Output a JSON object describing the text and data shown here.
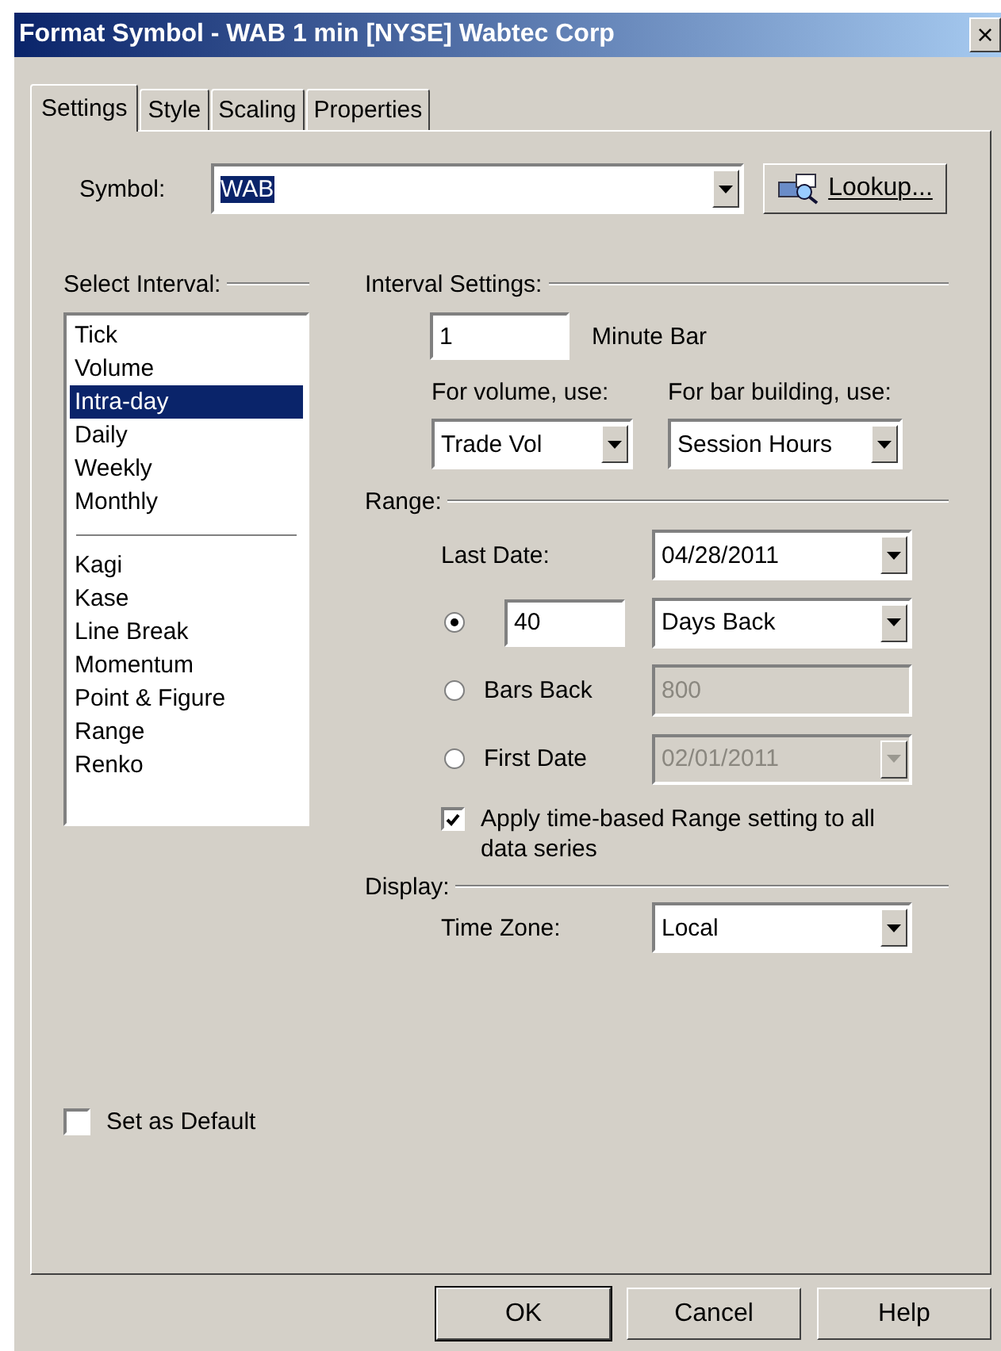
{
  "window": {
    "title": "Format Symbol - WAB 1 min [NYSE] Wabtec Corp",
    "close": "×"
  },
  "tabs": [
    {
      "label": "Settings",
      "selected": true
    },
    {
      "label": "Style",
      "selected": false
    },
    {
      "label": "Scaling",
      "selected": false
    },
    {
      "label": "Properties",
      "selected": false
    }
  ],
  "symbol": {
    "label": "Symbol:",
    "value": "WAB",
    "lookup": "Lookup..."
  },
  "select_interval": {
    "label": "Select Interval:",
    "groups": [
      {
        "items": [
          {
            "label": "Tick",
            "selected": false
          },
          {
            "label": "Volume",
            "selected": false
          },
          {
            "label": "Intra-day",
            "selected": true
          },
          {
            "label": "Daily",
            "selected": false
          },
          {
            "label": "Weekly",
            "selected": false
          },
          {
            "label": "Monthly",
            "selected": false
          }
        ]
      },
      {
        "items": [
          {
            "label": "Kagi",
            "selected": false
          },
          {
            "label": "Kase",
            "selected": false
          },
          {
            "label": "Line Break",
            "selected": false
          },
          {
            "label": "Momentum",
            "selected": false
          },
          {
            "label": "Point & Figure",
            "selected": false
          },
          {
            "label": "Range",
            "selected": false
          },
          {
            "label": "Renko",
            "selected": false
          }
        ]
      }
    ]
  },
  "interval_settings": {
    "label": "Interval Settings:",
    "value": "1",
    "unit": "Minute Bar",
    "volume_label": "For volume, use:",
    "volume": "Trade Vol",
    "building_label": "For bar building, use:",
    "building": "Session Hours"
  },
  "range": {
    "label": "Range:",
    "last_date_label": "Last Date:",
    "last_date": "04/28/2011",
    "options": [
      {
        "selected": true,
        "field": "40",
        "dropdown": "Days Back",
        "disabled": false
      },
      {
        "selected": false,
        "label": "Bars Back",
        "field": "800",
        "disabled": true
      },
      {
        "selected": false,
        "label": "First Date",
        "dropdown": "02/01/2011",
        "disabled": true
      }
    ],
    "apply_all": {
      "label": "Apply time-based Range setting to all data series",
      "checked": true
    }
  },
  "display": {
    "label": "Display:",
    "time_zone_label": "Time Zone:",
    "time_zone": "Local"
  },
  "set_as_default": {
    "label": "Set as Default",
    "checked": false
  },
  "buttons": [
    {
      "label": "OK",
      "default": true
    },
    {
      "label": "Cancel",
      "default": false
    },
    {
      "label": "Help",
      "default": false
    }
  ]
}
